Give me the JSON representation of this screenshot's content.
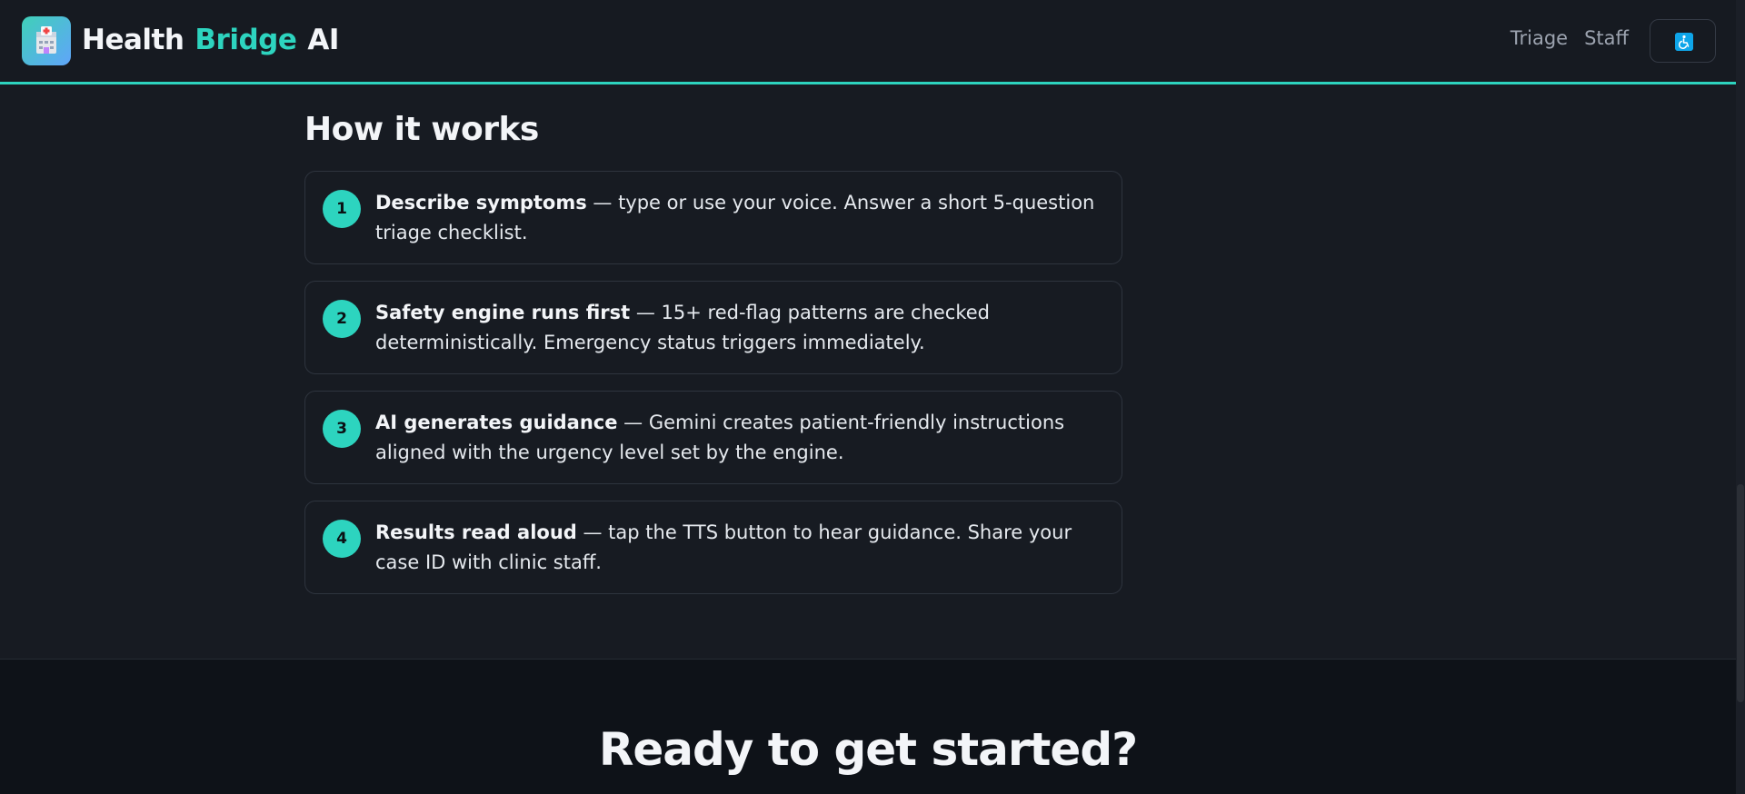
{
  "header": {
    "brand": {
      "word1": "Health",
      "word2": "Bridge",
      "word3": "AI"
    },
    "logo_icon": "hospital-icon",
    "nav": [
      {
        "label": "Triage"
      },
      {
        "label": "Staff"
      }
    ],
    "accessibility_icon": "wheelchair-icon",
    "accent_color": "#2dd4bf"
  },
  "how_it_works": {
    "title": "How it works",
    "steps": [
      {
        "number": "1",
        "heading": "Describe symptoms",
        "body": " — type or use your voice. Answer a short 5-question triage checklist."
      },
      {
        "number": "2",
        "heading": "Safety engine runs first",
        "body": " — 15+ red-flag patterns are checked deterministically. Emergency status triggers immediately."
      },
      {
        "number": "3",
        "heading": "AI generates guidance",
        "body": " — Gemini creates patient-friendly instructions aligned with the urgency level set by the engine."
      },
      {
        "number": "4",
        "heading": "Results read aloud",
        "body": " — tap the TTS button to hear guidance. Share your case ID with clinic staff."
      }
    ]
  },
  "cta": {
    "title": "Ready to get started?"
  }
}
